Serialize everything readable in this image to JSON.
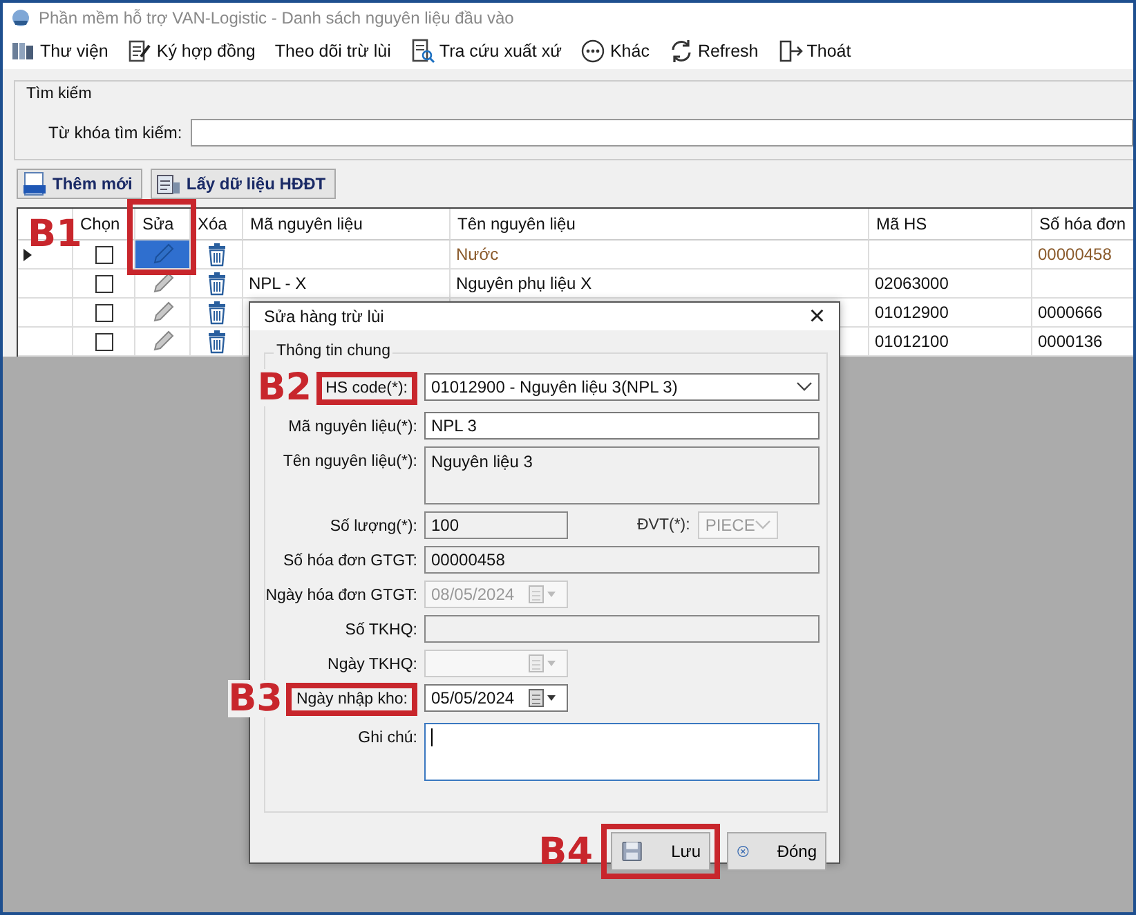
{
  "window": {
    "title": "Phần mềm hỗ trợ VAN-Logistic - Danh sách nguyên liệu đầu vào"
  },
  "toolbar": [
    {
      "label": "Thư viện",
      "kind": "library"
    },
    {
      "label": "Ký hợp đồng",
      "kind": "contract"
    },
    {
      "label": "Theo dõi trừ lùi",
      "kind": "none"
    },
    {
      "label": "Tra cứu xuất xứ",
      "kind": "lookup"
    },
    {
      "label": "Khác",
      "kind": "more"
    },
    {
      "label": "Refresh",
      "kind": "refresh"
    },
    {
      "label": "Thoát",
      "kind": "exit"
    }
  ],
  "search": {
    "title": "Tìm kiếm",
    "label": "Từ khóa tìm kiếm:"
  },
  "actions": [
    {
      "label": "Thêm mới",
      "kind": "new"
    },
    {
      "label": "Lấy dữ liệu HĐĐT",
      "kind": "fetch"
    }
  ],
  "table": {
    "columns": [
      {
        "label": "Chọn"
      },
      {
        "label": "Sửa",
        "marker": "B1"
      },
      {
        "label": "Xóa"
      },
      {
        "label": "Mã nguyên liệu"
      },
      {
        "label": "Tên nguyên liệu"
      },
      {
        "label": "Mã HS"
      },
      {
        "label": "Số hóa đơn"
      }
    ],
    "rows": [
      {
        "selected": true,
        "checked": false,
        "edit_active": true,
        "highlighted": true,
        "name": "Nước",
        "invoice": "00000458"
      },
      {
        "selected": false,
        "checked": false,
        "edit_active": false,
        "highlighted": false,
        "code": "NPL - X",
        "name": "Nguyên phụ liệu X",
        "hs": "02063000"
      },
      {
        "selected": false,
        "checked": false,
        "edit_active": false,
        "highlighted": false,
        "hs": "01012900",
        "invoice": "0000666"
      },
      {
        "selected": false,
        "checked": false,
        "edit_active": false,
        "highlighted": false,
        "hs": "01012100",
        "invoice": "0000136"
      }
    ]
  },
  "dialog": {
    "title": "Sửa hàng trừ lùi",
    "close": "×",
    "group": "Thông tin chung",
    "fields": [
      {
        "label": "HS code(*):",
        "kind": "combo",
        "value": "01012900 - Nguyên liệu 3(NPL 3)",
        "disabled": false,
        "readonly": false,
        "marker": "B2"
      },
      {
        "label": "Mã nguyên liệu(*):",
        "kind": "text",
        "value": "NPL 3",
        "disabled": false,
        "readonly": false
      },
      {
        "label": "Tên nguyên liệu(*):",
        "kind": "textarea",
        "value": "Nguyên liệu 3",
        "disabled": false,
        "readonly": true
      },
      {
        "label": "Số lượng(*):",
        "kind": "short",
        "value": "100",
        "disabled": false,
        "readonly": true,
        "side": {
          "label": "ĐVT(*):",
          "kind": "combo",
          "value": "PIECE",
          "disabled": true
        }
      },
      {
        "label": "Số hóa đơn GTGT:",
        "kind": "text",
        "value": "00000458",
        "disabled": false,
        "readonly": true
      },
      {
        "label": "Ngày hóa đơn GTGT:",
        "kind": "date",
        "value": "08/05/2024",
        "disabled": true,
        "readonly": false
      },
      {
        "label": "Số TKHQ:",
        "kind": "text",
        "disabled": false,
        "readonly": true
      },
      {
        "label": "Ngày TKHQ:",
        "kind": "date",
        "disabled": true,
        "readonly": false
      },
      {
        "label": "Ngày nhập kho:",
        "kind": "date",
        "value": "05/05/2024",
        "disabled": false,
        "readonly": false,
        "marker": "B3"
      },
      {
        "label": "Ghi chú:",
        "kind": "textarea",
        "disabled": false,
        "readonly": false,
        "focused": true
      }
    ],
    "buttons": [
      {
        "label": "Lưu",
        "kind": "save",
        "marker": "B4"
      },
      {
        "label": "Đóng",
        "kind": "close"
      }
    ]
  }
}
